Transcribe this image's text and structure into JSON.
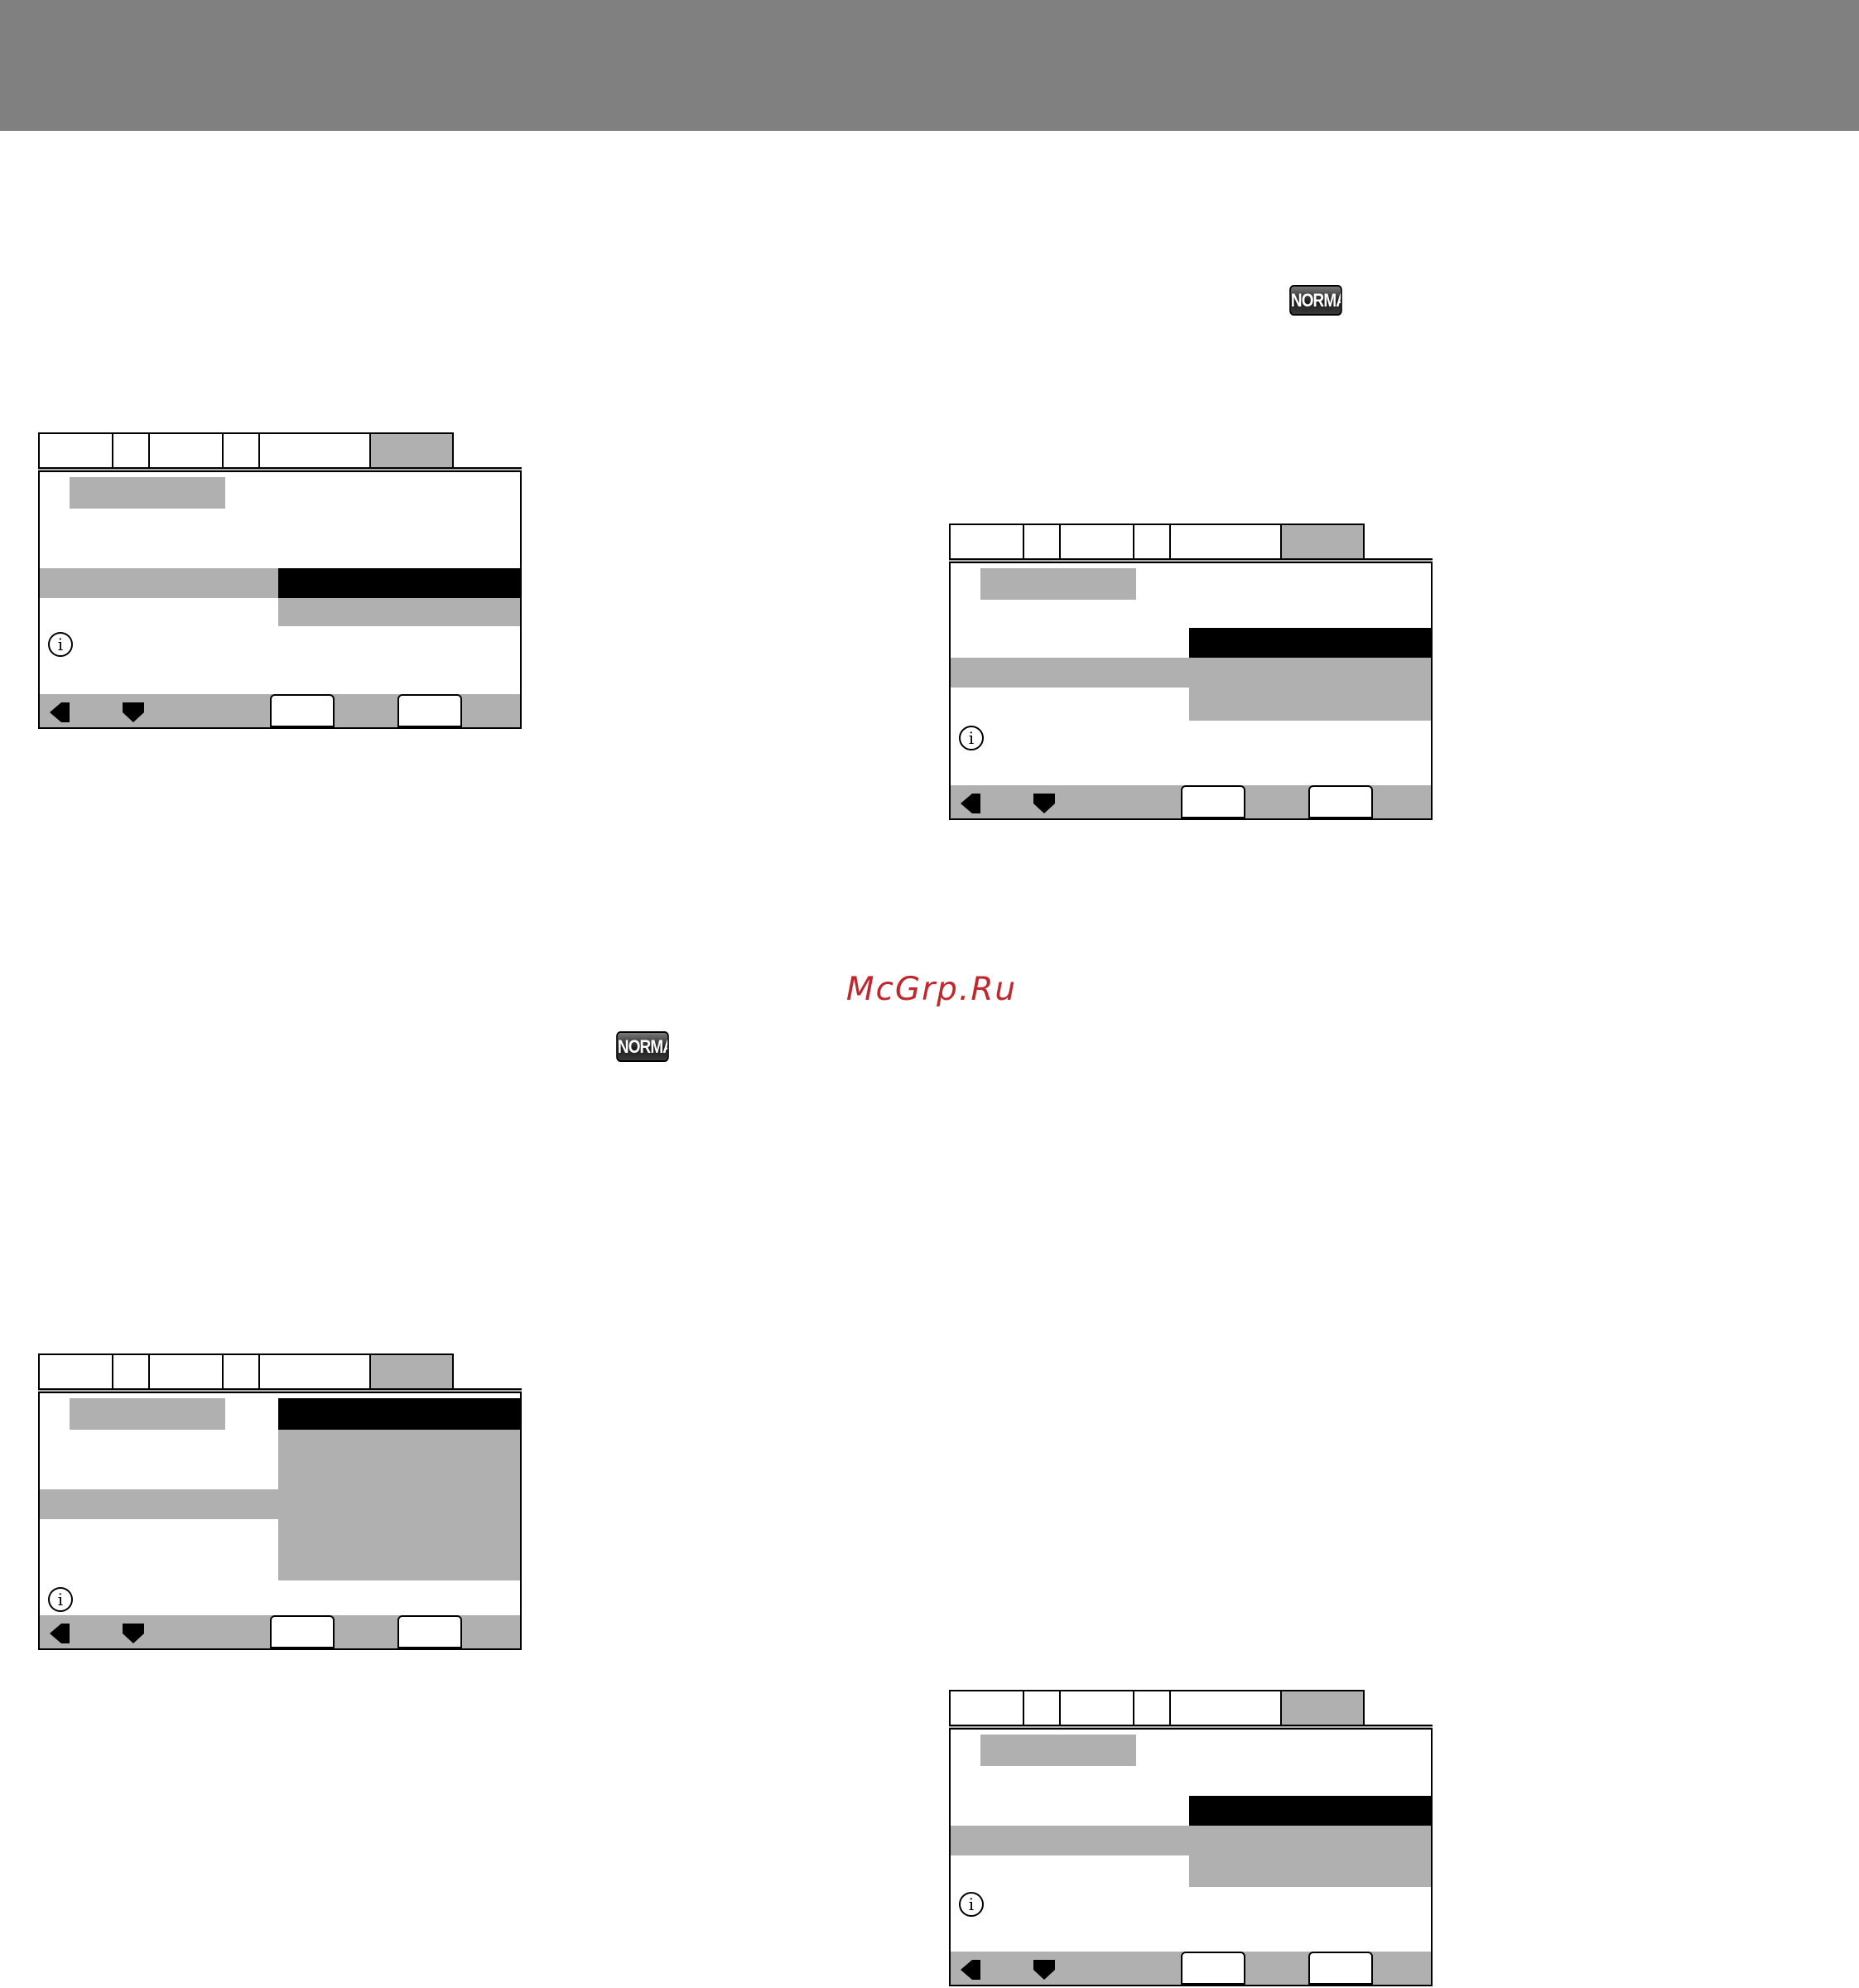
{
  "page": {
    "watermark": "McGrp.Ru",
    "badge_text": "NORMAL"
  },
  "osd_panels": [
    {
      "id": "panel-1",
      "info_symbol": "i"
    },
    {
      "id": "panel-2",
      "info_symbol": "i"
    },
    {
      "id": "panel-3",
      "info_symbol": "i"
    },
    {
      "id": "panel-4",
      "info_symbol": "i"
    }
  ],
  "icons": [
    "info-icon",
    "left-arrow-icon",
    "down-arrow-icon"
  ],
  "colors": {
    "header_band": "#808080",
    "highlight_grey": "#b0b0b0",
    "selection_black": "#000000",
    "watermark_red": "#c0282d"
  }
}
